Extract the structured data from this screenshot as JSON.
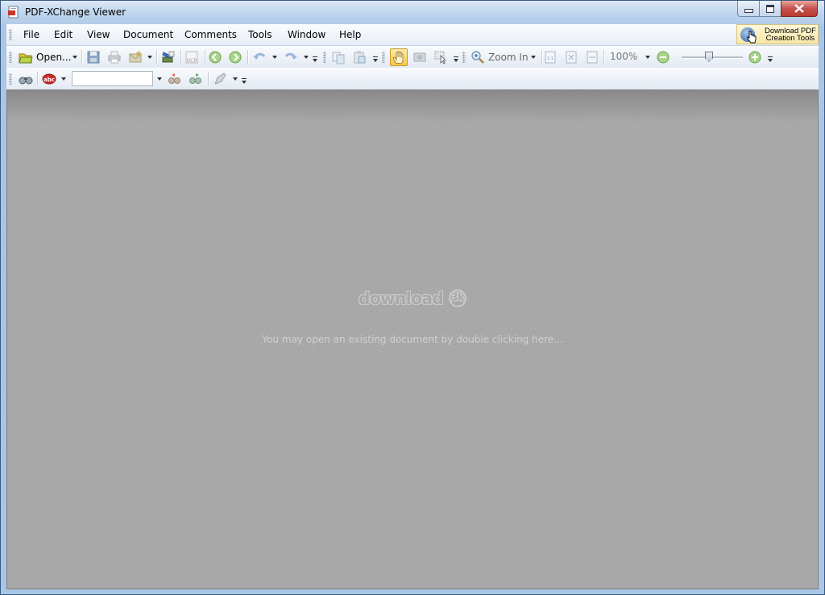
{
  "window": {
    "title": "PDF-XChange Viewer",
    "controls": {
      "minimize": "minimize",
      "maximize": "maximize",
      "close": "close"
    }
  },
  "menubar": {
    "items": [
      "File",
      "Edit",
      "View",
      "Document",
      "Comments",
      "Tools",
      "Window",
      "Help"
    ],
    "promo": {
      "line1": "Download PDF",
      "line2": "Creation Tools"
    }
  },
  "toolbar1": {
    "open_label": "Open...",
    "zoom_in_label": "Zoom In",
    "zoom_value": "100%",
    "zoom_slider_fraction": 0.45
  },
  "toolbar2": {
    "search_value": ""
  },
  "document": {
    "watermark": "download",
    "watermark_badge": "3k",
    "hint": "You may open an existing document by double clicking here..."
  },
  "colors": {
    "accent": "#f9d36a",
    "document_bg": "#a9a9a9",
    "title_bar": "#bcd3ec"
  },
  "icons": [
    "pdf-app-icon",
    "open-folder-icon",
    "save-icon",
    "print-icon",
    "email-icon",
    "scan-icon",
    "ocr-icon",
    "back-icon",
    "forward-icon",
    "undo-icon",
    "redo-icon",
    "copy-icon",
    "paste-icon",
    "hand-icon",
    "snapshot-icon",
    "select-icon",
    "zoom-in-icon",
    "actual-size-icon",
    "fit-page-icon",
    "fit-width-icon",
    "zoom-out-icon",
    "zoom-plus-icon",
    "binoculars-icon",
    "spell-icon",
    "search-prev-icon",
    "search-next-icon",
    "highlight-icon"
  ]
}
